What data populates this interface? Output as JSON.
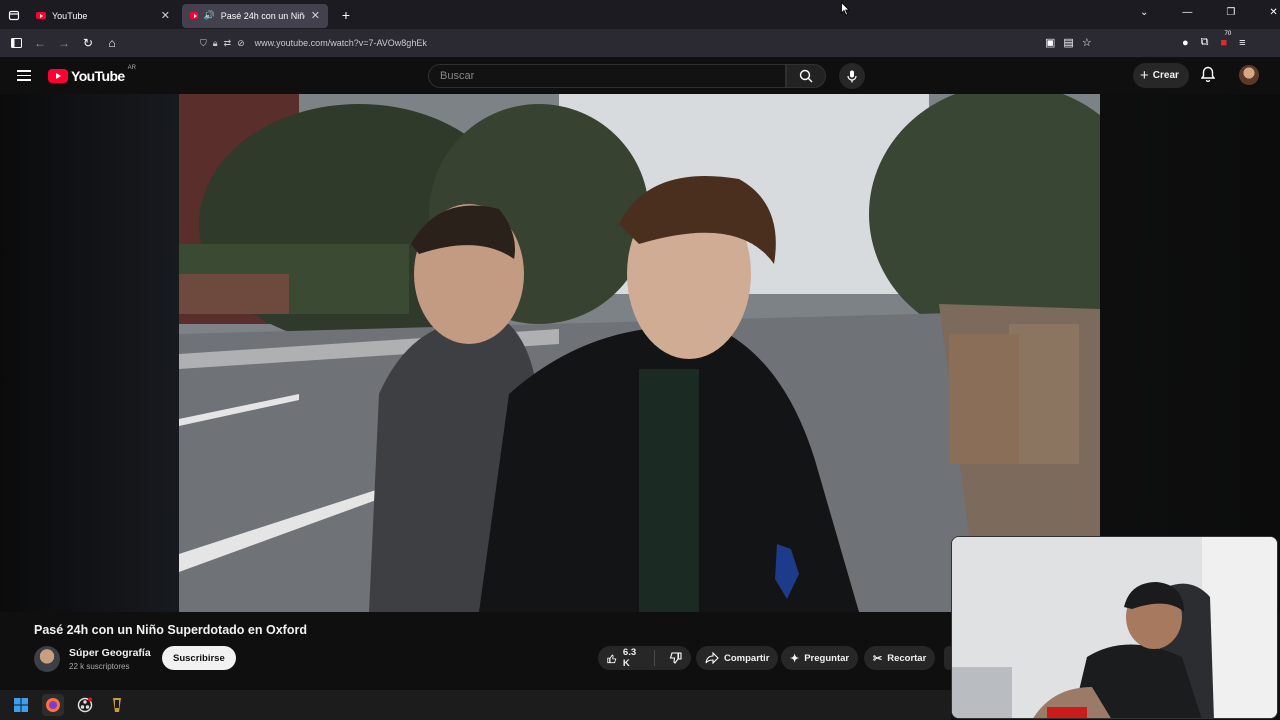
{
  "browser": {
    "tabs": [
      {
        "label": "YouTube",
        "active": false
      },
      {
        "label": "Pasé 24h con un Niño Supe",
        "active": true
      }
    ],
    "url": "www.youtube.com/watch?v=7-AVOw8ghEk",
    "extension_badge": "70"
  },
  "youtube": {
    "logo_text": "YouTube",
    "country_code": "AR",
    "search_placeholder": "Buscar",
    "create_label": "Crear"
  },
  "video": {
    "title": "Pasé 24h con un Niño Superdotado en Oxford",
    "channel_name": "Súper Geografía",
    "subscribers": "22 k suscriptores",
    "subscribe_label": "Suscribirse",
    "likes": "6.3 K",
    "share_label": "Compartir",
    "ask_label": "Preguntar",
    "clip_label": "Recortar"
  },
  "colors": {
    "accent_red": "#ff0033",
    "background": "#0f0f0f",
    "pill": "#272727"
  }
}
